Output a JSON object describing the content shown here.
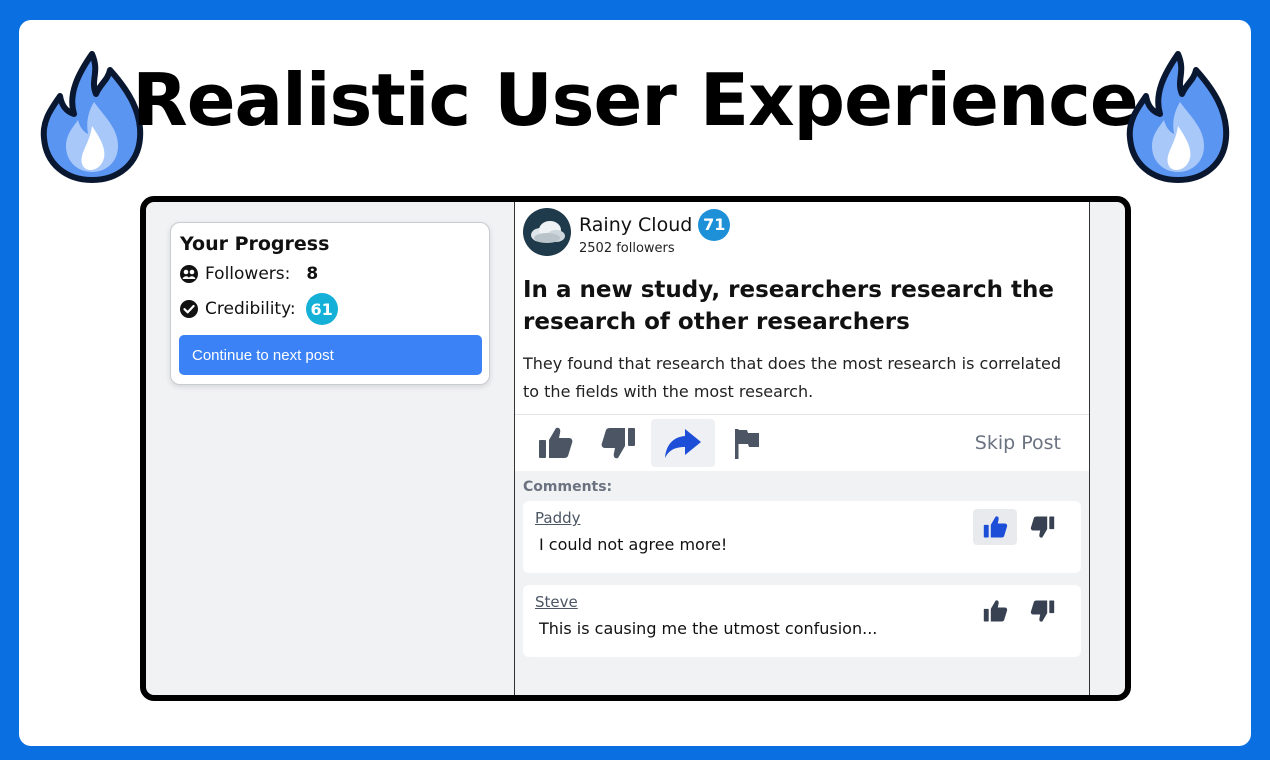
{
  "banner": {
    "title": "Realistic User Experience",
    "left_icon": "fire-icon",
    "right_icon": "fire-icon"
  },
  "progress": {
    "title": "Your Progress",
    "followers_label": "Followers:",
    "followers_value": "8",
    "credibility_label": "Credibility:",
    "credibility_value": "61",
    "next_button": "Continue to next post"
  },
  "post": {
    "author": "Rainy Cloud",
    "author_credibility": "71",
    "followers": "2502 followers",
    "title": "In a new study, researchers research the research of other researchers",
    "body": "They found that research that does the most research is correlated to the fields with the most research.",
    "actions": {
      "like_icon": "thumbs-up-icon",
      "dislike_icon": "thumbs-down-icon",
      "share_icon": "share-icon",
      "flag_icon": "flag-icon",
      "skip_label": "Skip Post"
    }
  },
  "comments": {
    "label": "Comments:",
    "items": [
      {
        "author": "Paddy",
        "text": "I could not agree more!",
        "liked": true
      },
      {
        "author": "Steve",
        "text": "This is causing me the utmost confusion...",
        "liked": false
      }
    ]
  },
  "colors": {
    "background": "#0a6fe0",
    "accent_blue": "#3b82f6",
    "credibility_badge": "#15b0d8",
    "author_badge": "#1e90d8",
    "share_active": "#1d4ed8",
    "icon_gray": "#4b5563"
  }
}
